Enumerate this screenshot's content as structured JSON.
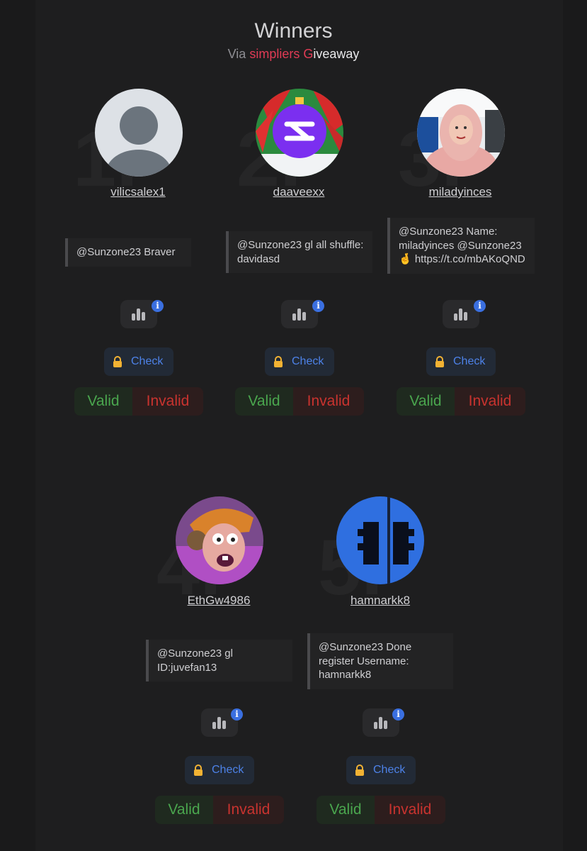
{
  "header": {
    "title": "Winners",
    "via": "Via",
    "brand_part1": "simpliers G",
    "brand_part2": "iveaway"
  },
  "winners": [
    {
      "rank": "1.",
      "username": "vilicsalex1",
      "comment": "@Sunzone23 Braver",
      "check_label": "Check",
      "valid_label": "Valid",
      "invalid_label": "Invalid",
      "avatar": "default-avatar-icon"
    },
    {
      "rank": "2.",
      "username": "daaveexx",
      "comment": "@Sunzone23 gl all shuffle: davidasd",
      "check_label": "Check",
      "valid_label": "Valid",
      "invalid_label": "Invalid",
      "avatar": "ornament-logo-avatar"
    },
    {
      "rank": "3.",
      "username": "miladyinces",
      "comment": "@Sunzone23 Name: miladyinces @Sunzone23 🤞 https://t.co/mbAKoQND",
      "check_label": "Check",
      "valid_label": "Valid",
      "invalid_label": "Invalid",
      "avatar": "photo-avatar"
    },
    {
      "rank": "4.",
      "username": "EthGw4986",
      "comment": "@Sunzone23 gl ID:juvefan13",
      "check_label": "Check",
      "valid_label": "Valid",
      "invalid_label": "Invalid",
      "avatar": "cartoon-avatar"
    },
    {
      "rank": "5.",
      "username": "hamnarkk8",
      "comment": "@Sunzone23 Done register Username: hamnarkk8",
      "check_label": "Check",
      "valid_label": "Valid",
      "invalid_label": "Invalid",
      "avatar": "traffic-light-avatar"
    }
  ],
  "icons": {
    "stats": "bar-chart-icon",
    "info": "info-icon",
    "lock": "lock-icon"
  },
  "colors": {
    "accent_blue": "#4d82e8",
    "valid_green": "#4aa64e",
    "invalid_red": "#c9332f",
    "brand_red": "#e03b55",
    "lock_yellow": "#f2b233"
  }
}
